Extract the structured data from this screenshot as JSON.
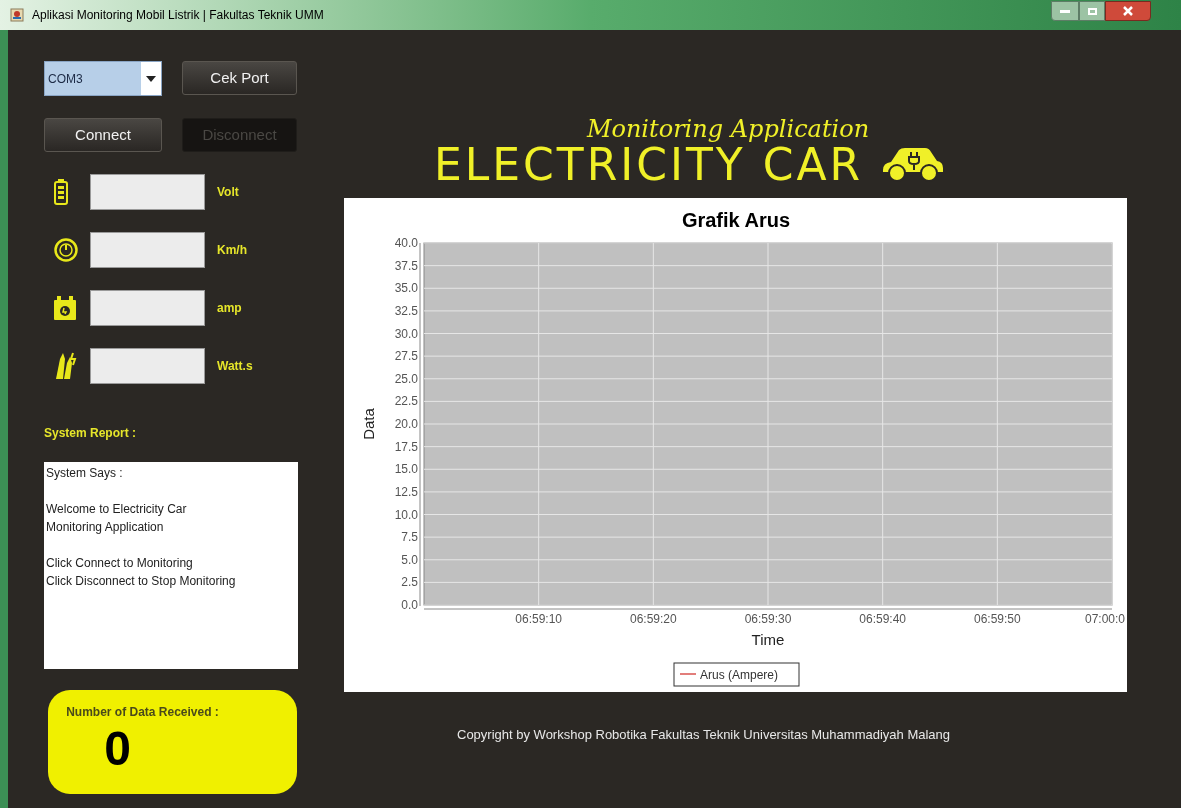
{
  "window": {
    "title": "Aplikasi Monitoring Mobil Listrik | Fakultas Teknik UMM"
  },
  "port_select": {
    "value": "COM3"
  },
  "buttons": [
    {
      "label": "Cek Port",
      "disabled": false
    },
    {
      "label": "Connect",
      "disabled": false
    },
    {
      "label": "Disconnect",
      "disabled": true
    }
  ],
  "readings": [
    {
      "kind": "voltage",
      "unit": "Volt"
    },
    {
      "kind": "speed",
      "unit": "Km/h"
    },
    {
      "kind": "current",
      "unit": "amp"
    },
    {
      "kind": "energy",
      "unit": "Watt.s"
    }
  ],
  "system_report": {
    "label": "System Report :",
    "paragraphs": [
      "System Says :",
      "Welcome to Electricity Car\nMonitoring Application",
      "Click Connect to Monitoring\nClick Disconnect to Stop Monitoring"
    ]
  },
  "counter": {
    "label": "Number of Data Received :",
    "value": "0"
  },
  "logo": {
    "subtitle": "Monitoring Application",
    "title": "ELECTRICITY CAR"
  },
  "chart": {
    "chart_data": {
      "type": "line",
      "title": "Grafik Arus",
      "xlabel": "Time",
      "ylabel": "Data",
      "ylim": [
        0,
        40
      ],
      "grid": true,
      "categories": [
        "06:59:10",
        "06:59:20",
        "06:59:30",
        "06:59:40",
        "06:59:50",
        "07:00:0"
      ],
      "yticks": [
        {
          "value": 0,
          "label": "0.0"
        },
        {
          "value": 2.5,
          "label": "2.5"
        },
        {
          "value": 5,
          "label": "5.0"
        },
        {
          "value": 7.5,
          "label": "7.5"
        },
        {
          "value": 10,
          "label": "10.0"
        },
        {
          "value": 12.5,
          "label": "12.5"
        },
        {
          "value": 15,
          "label": "15.0"
        },
        {
          "value": 17.5,
          "label": "17.5"
        },
        {
          "value": 20,
          "label": "20.0"
        },
        {
          "value": 22.5,
          "label": "22.5"
        },
        {
          "value": 25,
          "label": "25.0"
        },
        {
          "value": 27.5,
          "label": "27.5"
        },
        {
          "value": 30,
          "label": "30.0"
        },
        {
          "value": 32.5,
          "label": "32.5"
        },
        {
          "value": 35,
          "label": "35.0"
        },
        {
          "value": 37.5,
          "label": "37.5"
        },
        {
          "value": 40,
          "label": "40.0"
        }
      ],
      "series": [
        {
          "name": "Arus (Ampere)",
          "color": "#d9534f",
          "values": [
            null,
            null,
            null,
            null,
            null,
            null
          ]
        }
      ]
    }
  },
  "footer": "Copyright by Workshop Robotika Fakultas Teknik Universitas Muhammadiyah Malang"
}
